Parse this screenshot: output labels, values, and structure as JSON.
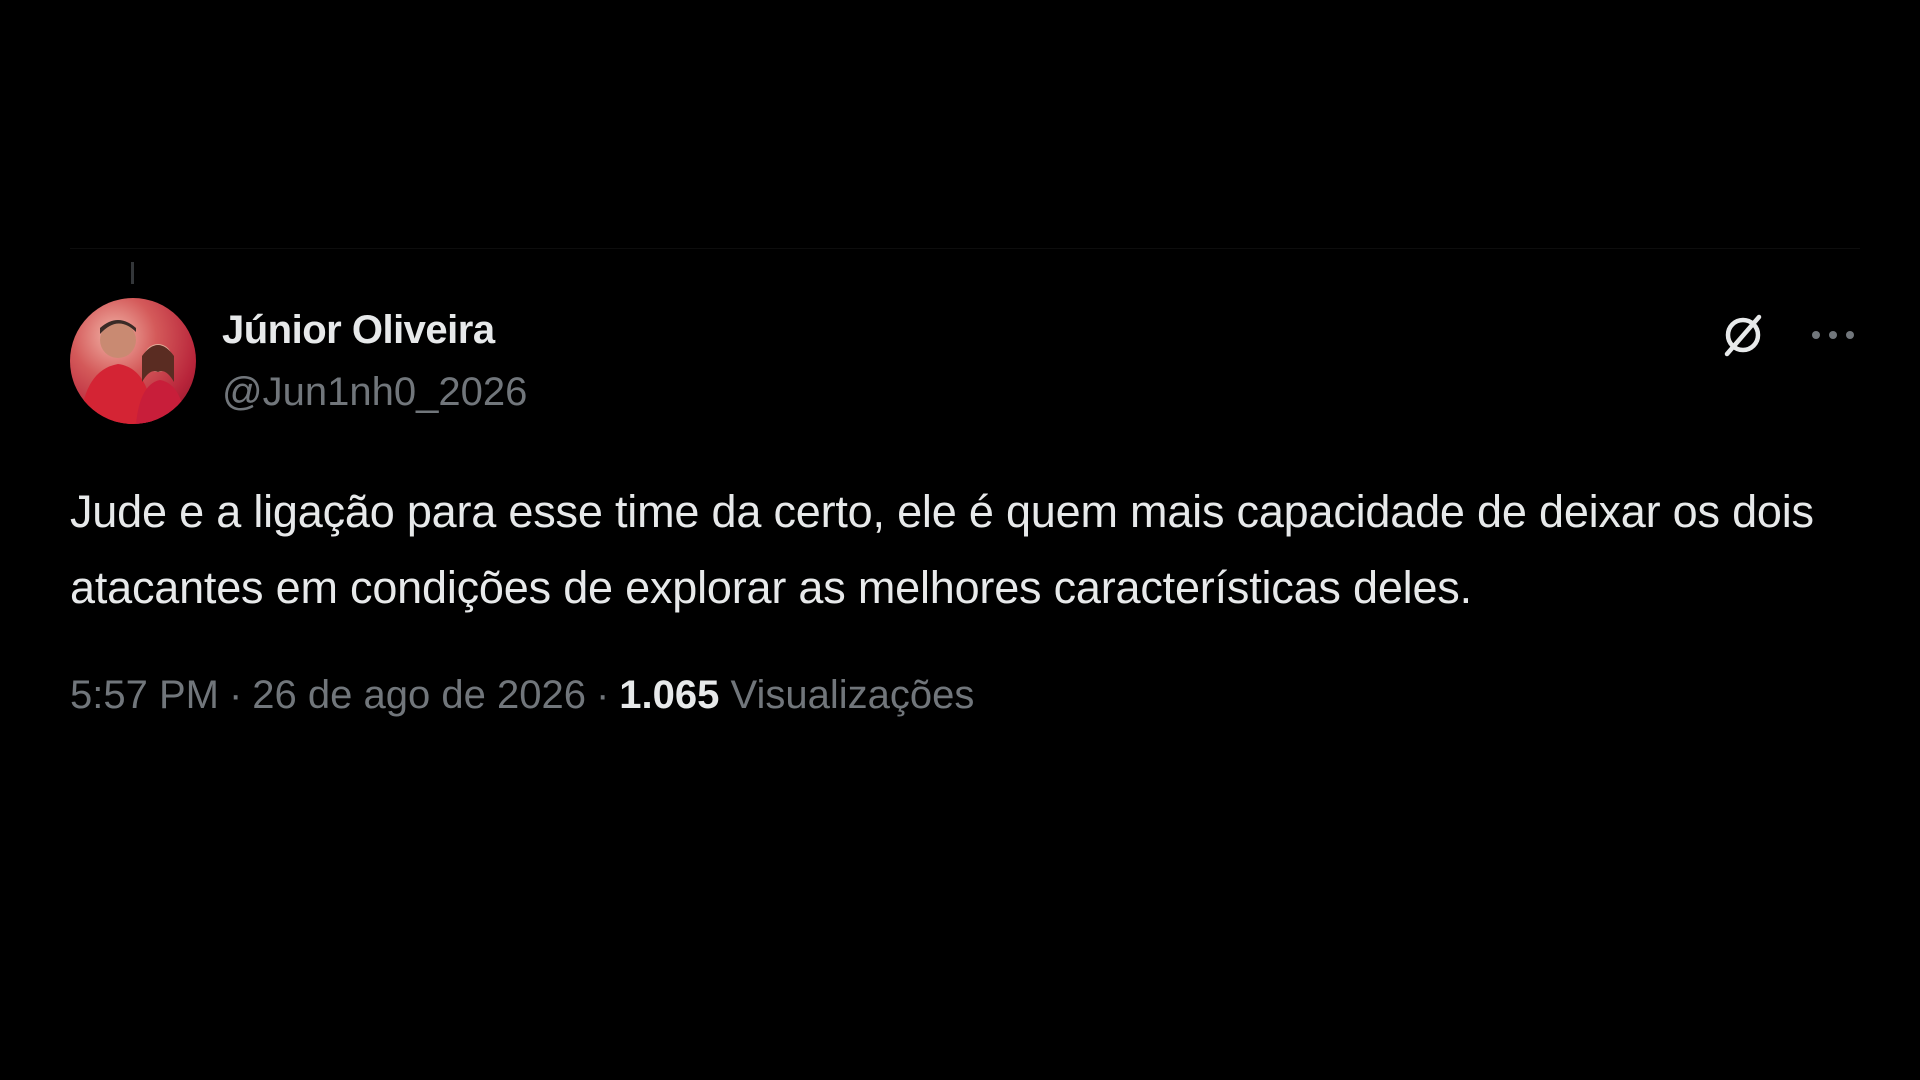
{
  "tweet": {
    "author": {
      "display_name": "Júnior Oliveira",
      "handle": "@Jun1nh0_2026"
    },
    "text": "Jude e a ligação para esse time da certo, ele é quem mais capacidade de deixar os dois atacantes em condições de explorar as melhores características deles.",
    "time": "5:57 PM",
    "separator": "·",
    "date": "26 de ago de 2026",
    "views_count": "1.065",
    "views_label": "Visualizações"
  },
  "icons": {
    "grok": "grok-icon",
    "more": "more-options-icon"
  },
  "colors": {
    "background": "#000000",
    "primary_text": "#e7e9ea",
    "secondary_text": "#71767b"
  }
}
